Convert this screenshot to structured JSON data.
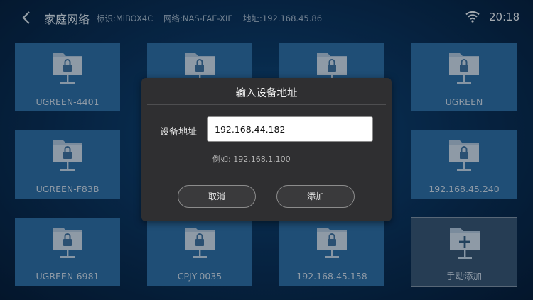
{
  "header": {
    "title": "家庭网络",
    "device_id": "标识:MiBOX4C",
    "network": "网络:NAS-FAE-XIE",
    "address": "地址:192.168.45.86",
    "time": "20:18"
  },
  "tiles": [
    {
      "label": "UGREEN-4401",
      "icon": "locked-folder-icon"
    },
    {
      "label": "",
      "icon": "locked-folder-icon"
    },
    {
      "label": "",
      "icon": "locked-folder-icon"
    },
    {
      "label": "UGREEN",
      "icon": "locked-folder-icon"
    },
    {
      "label": "UGREEN-F83B",
      "icon": "locked-folder-icon"
    },
    {
      "label": "192.168.45.240",
      "icon": "locked-folder-icon"
    },
    {
      "label": "UGREEN-6981",
      "icon": "locked-folder-icon"
    },
    {
      "label": "CPJY-0035",
      "icon": "locked-folder-icon"
    },
    {
      "label": "192.168.45.158",
      "icon": "locked-folder-icon"
    },
    {
      "label": "手动添加",
      "icon": "add-folder-icon"
    }
  ],
  "dialog": {
    "title": "输入设备地址",
    "field_label": "设备地址",
    "field_value": "192.168.44.182",
    "hint": "例如: 192.168.1.100",
    "cancel_label": "取消",
    "add_label": "添加"
  },
  "colors": {
    "tile": "#2b6da4",
    "dialog": "#2f2f31",
    "background": "#0a3561"
  }
}
